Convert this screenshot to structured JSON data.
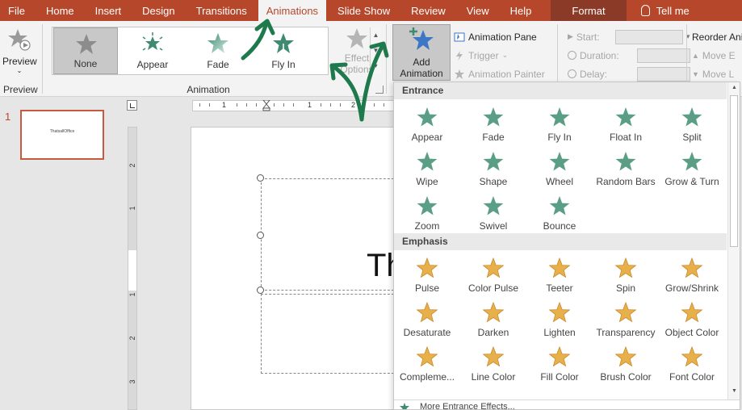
{
  "menu": {
    "items": [
      "File",
      "Home",
      "Insert",
      "Design",
      "Transitions",
      "Animations",
      "Slide Show",
      "Review",
      "View",
      "Help"
    ],
    "active": "Animations",
    "format": "Format",
    "tell_me": "Tell me"
  },
  "colors": {
    "brand": "#b7472a",
    "entrance": "#5a9e85",
    "emphasis": "#e8b04b",
    "annotation": "#1e7a4c"
  },
  "ribbon": {
    "preview": {
      "label": "Preview",
      "group_label": "Preview"
    },
    "animation_group_label": "Animation",
    "gallery": [
      {
        "label": "None",
        "icon": "star-none-icon"
      },
      {
        "label": "Appear",
        "icon": "star-appear-icon"
      },
      {
        "label": "Fade",
        "icon": "star-fade-icon"
      },
      {
        "label": "Fly In",
        "icon": "star-flyin-icon"
      }
    ],
    "effect_options": {
      "line1": "Effect",
      "line2": "Options"
    },
    "add_animation": {
      "line1": "Add",
      "line2": "Animation"
    },
    "advanced": {
      "animation_pane": "Animation Pane",
      "trigger": "Trigger",
      "animation_painter": "Animation Painter"
    },
    "timing": {
      "start": "Start:",
      "duration": "Duration:",
      "delay": "Delay:"
    },
    "reorder": {
      "title": "Reorder Ani",
      "move_earlier": "Move E",
      "move_later": "Move L"
    }
  },
  "slides": {
    "current_number": "1",
    "thumb_text": "ThatsallOffice"
  },
  "rulers": {
    "horizontal": [
      "1",
      "1",
      "2"
    ],
    "vertical": [
      "2",
      "1",
      "1",
      "2",
      "3"
    ]
  },
  "slide": {
    "title_partial": "Th"
  },
  "dropdown": {
    "entrance": {
      "header": "Entrance",
      "effects": [
        "Appear",
        "Fade",
        "Fly In",
        "Float In",
        "Split",
        "Wipe",
        "Shape",
        "Wheel",
        "Random Bars",
        "Grow & Turn",
        "Zoom",
        "Swivel",
        "Bounce"
      ]
    },
    "emphasis": {
      "header": "Emphasis",
      "effects": [
        "Pulse",
        "Color Pulse",
        "Teeter",
        "Spin",
        "Grow/Shrink",
        "Desaturate",
        "Darken",
        "Lighten",
        "Transparency",
        "Object Color",
        "Compleme...",
        "Line Color",
        "Fill Color",
        "Brush Color",
        "Font Color"
      ]
    },
    "more_entrance": "More Entrance Effects..."
  }
}
